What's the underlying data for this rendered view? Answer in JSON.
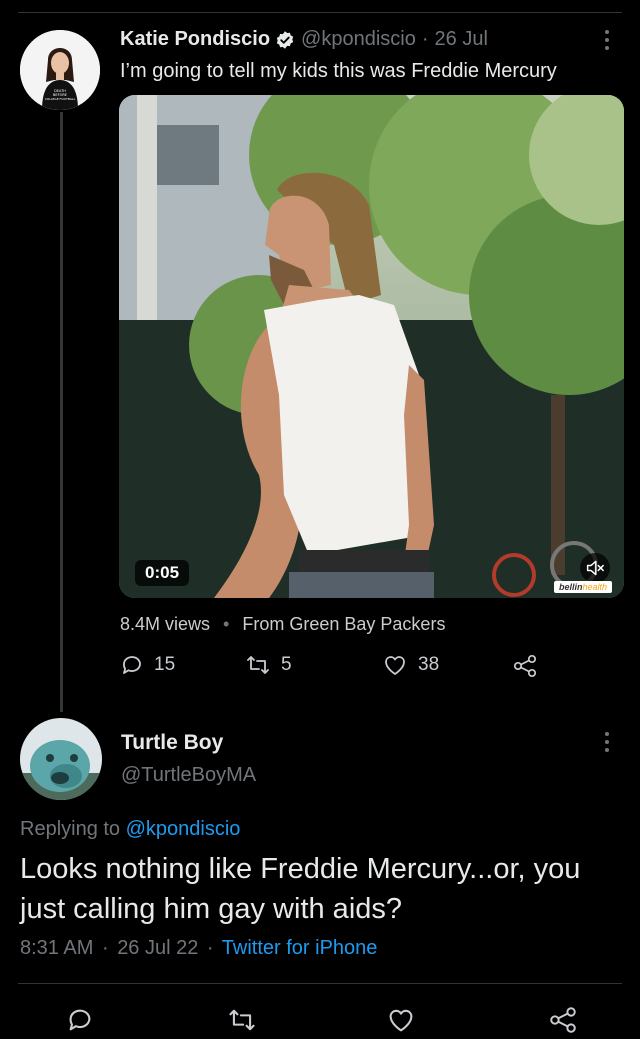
{
  "original_tweet": {
    "display_name": "Katie Pondiscio",
    "handle": "@kpondiscio",
    "separator": "·",
    "date": "26 Jul",
    "text": "I’m going to tell my kids this was Freddie Mercury",
    "avatar_shirt_text": "DEATH\nBEFORE\nCOLLEGE FOOTBALL",
    "video": {
      "duration": "0:05",
      "watermark_brand": "bellin",
      "watermark_sub": "health"
    },
    "views": "8.4M views",
    "source_separator": "•",
    "source": "From Green Bay Packers",
    "replies": "15",
    "retweets": "5",
    "likes": "38"
  },
  "reply_tweet": {
    "display_name": "Turtle Boy",
    "handle": "@TurtleBoyMA",
    "replying_prefix": "Replying to",
    "replying_to": "@kpondiscio",
    "text": "Looks nothing like Freddie Mercury...or, you just calling him gay with aids?",
    "time": "8:31 AM",
    "date": "26 Jul 22",
    "separator": "·",
    "client": "Twitter for iPhone"
  },
  "colors": {
    "background": "#000000",
    "text": "#e7e9ea",
    "muted": "#71767b",
    "accent": "#1d9bf0",
    "verified": "#e7e9ea"
  },
  "icons": [
    "more-icon",
    "verified-badge-icon",
    "reply-icon",
    "retweet-icon",
    "like-icon",
    "share-icon",
    "mute-icon"
  ]
}
